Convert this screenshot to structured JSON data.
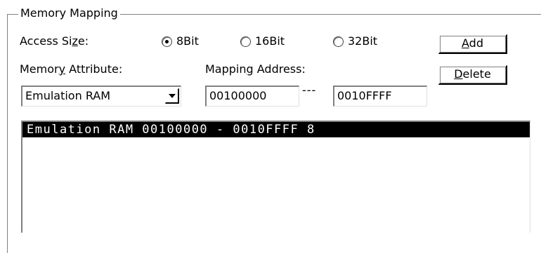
{
  "group": {
    "title": "Memory Mapping"
  },
  "access_size": {
    "label_pre": "Access Si",
    "label_ul": "z",
    "label_post": "e:",
    "options": [
      {
        "label": "8Bit",
        "selected": true
      },
      {
        "label": "16Bit",
        "selected": false
      },
      {
        "label": "32Bit",
        "selected": false
      }
    ]
  },
  "memory_attribute": {
    "label_pre": "Memor",
    "label_ul": "y",
    "label_post": " Attribute:",
    "value": "Emulation RAM"
  },
  "mapping_address": {
    "label_pre": "Mappin",
    "label_ul": "g",
    "label_post": " Address:",
    "start": "00100000",
    "separator": "---",
    "end": "0010FFFF"
  },
  "buttons": {
    "add": {
      "ul": "A",
      "rest": "dd"
    },
    "delete": {
      "ul": "D",
      "rest": "elete"
    }
  },
  "mapping_list": [
    "Emulation RAM 00100000 - 0010FFFF 8"
  ]
}
